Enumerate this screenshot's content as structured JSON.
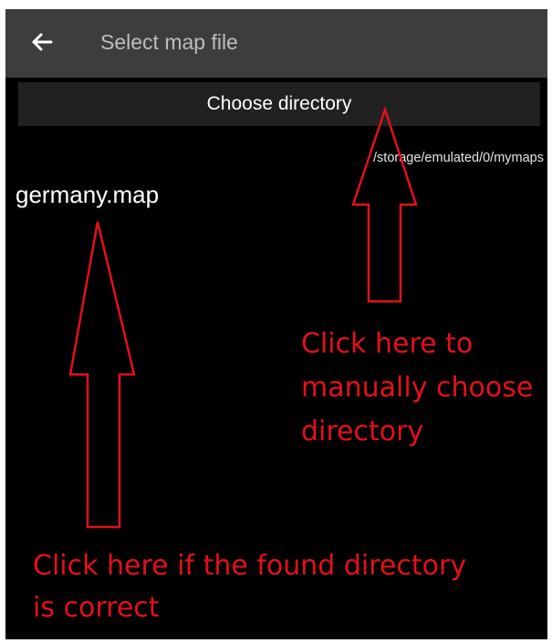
{
  "appbar": {
    "back_icon": "arrow-left-icon",
    "title": "Select map file"
  },
  "choose_directory": {
    "label": "Choose directory"
  },
  "directory_path": "/storage/emulated/0/mymaps",
  "map_files": [
    {
      "name": "germany.map"
    }
  ],
  "annotations": {
    "right": [
      "Click here to",
      "manually choose",
      "directory"
    ],
    "bottom": [
      "Click here if the found directory",
      "is correct"
    ],
    "color": "#e3101b"
  },
  "colors": {
    "appbar_bg": "#3d3d3d",
    "screen_bg": "#000000",
    "button_bg": "#212121"
  }
}
